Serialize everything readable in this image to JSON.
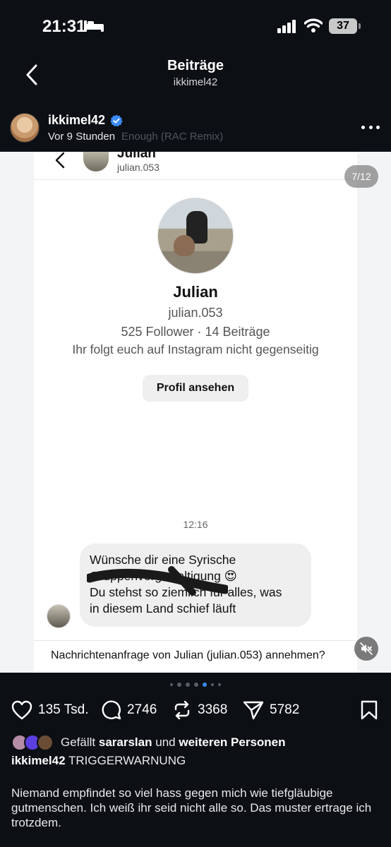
{
  "status_bar": {
    "time": "21:31",
    "battery": "37"
  },
  "header": {
    "title": "Beiträge",
    "subtitle": "ikkimel42"
  },
  "post": {
    "author": "ikkimel42",
    "time": "Vor 9 Stunden",
    "music_overlay": "Enough (RAC Remix)",
    "image_counter": "7/12"
  },
  "dm_screenshot": {
    "header_name": "Julian",
    "header_username": "julian.053",
    "profile_name": "Julian",
    "profile_username": "julian.053",
    "profile_stats": "525 Follower · 14 Beiträge",
    "mutual_info": "Ihr folgt euch auf Instagram nicht gegenseitig",
    "view_profile_button": "Profil ansehen",
    "message_time": "12:16",
    "message_lines": [
      "Wünsche dir eine Syrische",
      "Gruppenvergewaltigung 😍",
      "Du stehst so ziemlich für alles, was",
      "in diesem Land schief läuft"
    ],
    "request_text": "Nachrichtenanfrage von Julian (julian.053) annehmen?"
  },
  "actions": {
    "likes": "135 Tsd.",
    "comments": "2746",
    "reposts": "3368",
    "shares": "5782"
  },
  "liked_by": {
    "prefix": "Gefällt",
    "user": "sararslan",
    "connector": "und",
    "others": "weiteren Personen"
  },
  "caption": {
    "author": "ikkimel42",
    "headline": "TRIGGERWARNUNG",
    "body": "Niemand empfindet so viel hass gegen mich wie tiefgläubige gutmenschen. Ich weiß ihr seid nicht alle so. Das muster ertrage ich trotzdem."
  },
  "carousel": {
    "total": 7,
    "active_index": 5
  },
  "colors": {
    "background": "#0c0f14",
    "accent": "#3b8cff",
    "verified": "#3b8cff"
  }
}
